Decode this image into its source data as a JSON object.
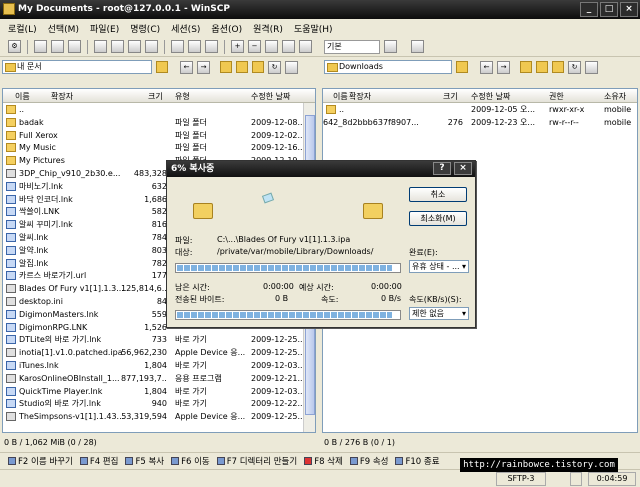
{
  "window": {
    "title": "My Documents - root@127.0.0.1 - WinSCP",
    "buttons": [
      "_",
      "□",
      "×"
    ]
  },
  "menu": [
    "로컬(L)",
    "선택(M)",
    "파일(E)",
    "명령(C)",
    "세션(S)",
    "옵션(O)",
    "원격(R)",
    "도움말(H)"
  ],
  "toolbar": {
    "session_label": "기본"
  },
  "left_path": "내 문서",
  "right_path": "Downloads",
  "left_headers": {
    "name": "이름",
    "ext": "확장자",
    "size": "크기",
    "type": "유형",
    "modified": "수정한 날짜"
  },
  "right_headers": {
    "name": "이름",
    "ext": "확장자",
    "size": "크기",
    "modified": "수정한 날짜",
    "rights": "권한",
    "owner": "소유자"
  },
  "left_rows": [
    {
      "name": "..",
      "size": "",
      "type": "",
      "date": "",
      "icon": "folder"
    },
    {
      "name": "badak",
      "size": "",
      "type": "파일 폴더",
      "date": "2009-12-08...",
      "icon": "folder"
    },
    {
      "name": "Full Xerox",
      "size": "",
      "type": "파일 폴더",
      "date": "2009-12-02...",
      "icon": "folder"
    },
    {
      "name": "My Music",
      "size": "",
      "type": "파일 폴더",
      "date": "2009-12-16...",
      "icon": "folder"
    },
    {
      "name": "My Pictures",
      "size": "",
      "type": "파일 폴더",
      "date": "2009-12-19...",
      "icon": "folder"
    },
    {
      "name": "3DP_Chip_v910_2b30.e...",
      "size": "483,328",
      "type": "",
      "date": "",
      "icon": "exe"
    },
    {
      "name": "마비노기.lnk",
      "size": "632",
      "type": "",
      "date": "",
      "icon": "lnk"
    },
    {
      "name": "바닥 인코더.lnk",
      "size": "1,686",
      "type": "",
      "date": "",
      "icon": "lnk"
    },
    {
      "name": "싹쓸이.LNK",
      "size": "582",
      "type": "",
      "date": "",
      "icon": "lnk"
    },
    {
      "name": "알씨 꾸미기.lnk",
      "size": "816",
      "type": "",
      "date": "",
      "icon": "lnk"
    },
    {
      "name": "알씨.lnk",
      "size": "784",
      "type": "",
      "date": "",
      "icon": "lnk"
    },
    {
      "name": "알약.lnk",
      "size": "803",
      "type": "",
      "date": "",
      "icon": "lnk"
    },
    {
      "name": "알집.lnk",
      "size": "782",
      "type": "",
      "date": "",
      "icon": "lnk"
    },
    {
      "name": "카르스 바로가기.url",
      "size": "177",
      "type": "",
      "date": "",
      "icon": "lnk"
    },
    {
      "name": "Blades Of Fury v1[1].1.3....",
      "size": "125,814,6...",
      "type": "",
      "date": "",
      "icon": "exe"
    },
    {
      "name": "desktop.ini",
      "size": "84",
      "type": "",
      "date": "",
      "icon": "exe"
    },
    {
      "name": "DigimonMasters.lnk",
      "size": "559",
      "type": "",
      "date": "",
      "icon": "lnk"
    },
    {
      "name": "DigimonRPG.LNK",
      "size": "1,526",
      "type": "",
      "date": "",
      "icon": "lnk"
    },
    {
      "name": "DTLite의 바로 가기.lnk",
      "size": "733",
      "type": "바로 가기",
      "date": "2009-12-25...",
      "icon": "lnk"
    },
    {
      "name": "inotia[1].v1.0.patched.ipa",
      "size": "56,962,230",
      "type": "Apple Device 응...",
      "date": "2009-12-25...",
      "icon": "exe"
    },
    {
      "name": "iTunes.lnk",
      "size": "1,804",
      "type": "바로 가기",
      "date": "2009-12-03...",
      "icon": "lnk"
    },
    {
      "name": "KarosOnlineOBInstall_1...",
      "size": "877,193,7...",
      "type": "응용 프로그램",
      "date": "2009-12-21...",
      "icon": "exe"
    },
    {
      "name": "QuickTime Player.lnk",
      "size": "1,804",
      "type": "바로 가기",
      "date": "2009-12-03...",
      "icon": "lnk"
    },
    {
      "name": "Studio의 바로 가기.lnk",
      "size": "940",
      "type": "바로 가기",
      "date": "2009-12-22...",
      "icon": "lnk"
    },
    {
      "name": "TheSimpsons-v1[1].1.43...",
      "size": "53,319,594",
      "type": "Apple Device 응...",
      "date": "2009-12-25...",
      "icon": "exe"
    }
  ],
  "right_rows": [
    {
      "name": "..",
      "size": "",
      "date": "2009-12-05 오...",
      "rights": "rwxr-xr-x",
      "owner": "mobile",
      "icon": "folder"
    },
    {
      "name": "642_8d2bbb637f8907...",
      "size": "276",
      "date": "2009-12-23 오...",
      "rights": "rw-r--r--",
      "owner": "mobile",
      "icon": "exe"
    }
  ],
  "status": {
    "left": "0 B / 1,062 MiB (0 / 28)",
    "right": "0 B / 276 B (0 / 1)"
  },
  "fkeys": [
    "F2 이름 바꾸기",
    "F4 편집",
    "F5 복사",
    "F6 이동",
    "F7 디렉터리 만들기",
    "F8 삭제",
    "F9 속성",
    "F10 종료"
  ],
  "bottom": {
    "protocol": "SFTP-3",
    "time": "0:04:59"
  },
  "watermark": "http://rainbowce.tistory.com",
  "dialog": {
    "title": "6% 복사중",
    "help_btn": "?",
    "close_btn": "×",
    "cancel_label": "취소",
    "minimize_label": "최소화(M)",
    "file_label": "파일:",
    "file_value": "C:\\...\\Blades Of Fury v1[1].1.3.ipa",
    "target_label": "대상:",
    "target_value": "/private/var/mobile/Library/Downloads/",
    "done_label": "완료(E):",
    "done_value": "유휴 상태 - ...",
    "remaining_label": "남은 시간:",
    "remaining_value": "0:00:00",
    "estimated_label": "예상 시간:",
    "estimated_value": "0:00:00",
    "transferred_label": "전송된 바이트:",
    "transferred_value": "0 B",
    "speed_label": "속도:",
    "speed_value": "0 B/s",
    "speedlimit_label": "속도(KB/s)(S):",
    "speedlimit_value": "제한 없음",
    "progress_file": 0.97,
    "progress_total": 0.97
  }
}
